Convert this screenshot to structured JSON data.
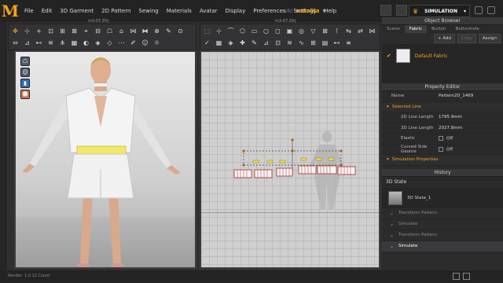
{
  "menu": {
    "logo": "M",
    "items": [
      "File",
      "Edit",
      "3D Garment",
      "2D Pattern",
      "Sewing",
      "Materials",
      "Avatar",
      "Display",
      "Preferences",
      "Settings",
      "Help"
    ]
  },
  "user": {
    "prefix": "miki",
    "name": "natalija"
  },
  "mode": {
    "label": "SIMULATION"
  },
  "viewports": {
    "title_3d": "m3-07.Zfrj",
    "title_2d": "m3-07.Zfrj"
  },
  "object_browser": {
    "title": "Object Browser",
    "tabs": [
      "Scene",
      "Fabric",
      "Button",
      "Buttonhole"
    ],
    "active_tab": "Fabric",
    "actions": {
      "add": "+ Add",
      "copy": "Copy",
      "assign": "Assign"
    },
    "fabric_item": "Default Fabric"
  },
  "property_editor": {
    "title": "Property Editor",
    "name_label": "Name",
    "name_value": "Pattern2D_1469",
    "section_selected": "Selected Line",
    "rows": [
      {
        "label": "2D Line Length",
        "value": "1795.9mm"
      },
      {
        "label": "3D Line Length",
        "value": "2027.8mm"
      },
      {
        "label": "Elastic",
        "value": "Off"
      },
      {
        "label": "Curved Side Geome",
        "value": "Off"
      }
    ],
    "section_sim": "Simulation Properties"
  },
  "history": {
    "title": "History",
    "header": "3D State",
    "state_label": "3D State_1",
    "items": [
      {
        "label": "Transform Pattern",
        "active": false
      },
      {
        "label": "Simulate",
        "active": false
      },
      {
        "label": "Transform Pattern",
        "active": false
      },
      {
        "label": "Simulate",
        "active": true
      }
    ]
  },
  "status": {
    "text": "Render: 1.0.12   Count"
  }
}
